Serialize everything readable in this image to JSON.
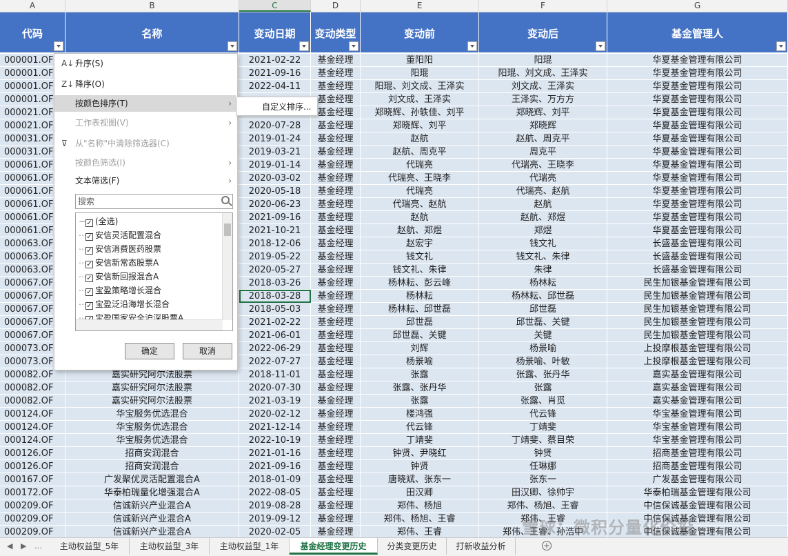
{
  "column_letters": [
    "A",
    "B",
    "C",
    "D",
    "E",
    "F",
    "G"
  ],
  "headers": [
    "代码",
    "名称",
    "变动日期",
    "变动类型",
    "变动前",
    "变动后",
    "基金管理人"
  ],
  "rows": [
    [
      "000001.OF",
      "",
      "2021-02-22",
      "基金经理",
      "董阳阳",
      "阳琨",
      "华夏基金管理有限公司"
    ],
    [
      "000001.OF",
      "",
      "2021-09-16",
      "基金经理",
      "阳琨",
      "阳琨、刘文成、王泽实",
      "华夏基金管理有限公司"
    ],
    [
      "000001.OF",
      "",
      "2022-04-11",
      "基金经理",
      "阳琨、刘文成、王泽实",
      "刘文成、王泽实",
      "华夏基金管理有限公司"
    ],
    [
      "000001.OF",
      "",
      "",
      "基金经理",
      "刘文成、王泽实",
      "王泽实、万方方",
      "华夏基金管理有限公司"
    ],
    [
      "000021.OF",
      "",
      "",
      "基金经理",
      "郑晓辉、孙轶佳、刘平",
      "郑晓辉、刘平",
      "华夏基金管理有限公司"
    ],
    [
      "000021.OF",
      "",
      "2020-07-28",
      "基金经理",
      "郑晓辉、刘平",
      "郑晓辉",
      "华夏基金管理有限公司"
    ],
    [
      "000031.OF",
      "",
      "2019-01-24",
      "基金经理",
      "赵航",
      "赵航、周克平",
      "华夏基金管理有限公司"
    ],
    [
      "000031.OF",
      "",
      "2019-03-21",
      "基金经理",
      "赵航、周克平",
      "周克平",
      "华夏基金管理有限公司"
    ],
    [
      "000061.OF",
      "",
      "2019-01-14",
      "基金经理",
      "代瑞亮",
      "代瑞亮、王晓李",
      "华夏基金管理有限公司"
    ],
    [
      "000061.OF",
      "",
      "2020-03-02",
      "基金经理",
      "代瑞亮、王晓李",
      "代瑞亮",
      "华夏基金管理有限公司"
    ],
    [
      "000061.OF",
      "",
      "2020-05-18",
      "基金经理",
      "代瑞亮",
      "代瑞亮、赵航",
      "华夏基金管理有限公司"
    ],
    [
      "000061.OF",
      "",
      "2020-06-23",
      "基金经理",
      "代瑞亮、赵航",
      "赵航",
      "华夏基金管理有限公司"
    ],
    [
      "000061.OF",
      "",
      "2021-09-16",
      "基金经理",
      "赵航",
      "赵航、郑煜",
      "华夏基金管理有限公司"
    ],
    [
      "000061.OF",
      "",
      "2021-10-21",
      "基金经理",
      "赵航、郑煜",
      "郑煜",
      "华夏基金管理有限公司"
    ],
    [
      "000063.OF",
      "",
      "2018-12-06",
      "基金经理",
      "赵宏宇",
      "钱文礼",
      "长盛基金管理有限公司"
    ],
    [
      "000063.OF",
      "",
      "2019-05-22",
      "基金经理",
      "钱文礼",
      "钱文礼、朱律",
      "长盛基金管理有限公司"
    ],
    [
      "000063.OF",
      "",
      "2020-05-27",
      "基金经理",
      "钱文礼、朱律",
      "朱律",
      "长盛基金管理有限公司"
    ],
    [
      "000067.OF",
      "",
      "2018-03-26",
      "基金经理",
      "杨林耘、彭云峰",
      "杨林耘",
      "民生加银基金管理有限公司"
    ],
    [
      "000067.OF",
      "",
      "2018-03-28",
      "基金经理",
      "杨林耘",
      "杨林耘、邱世磊",
      "民生加银基金管理有限公司"
    ],
    [
      "000067.OF",
      "",
      "2018-05-03",
      "基金经理",
      "杨林耘、邱世磊",
      "邱世磊",
      "民生加银基金管理有限公司"
    ],
    [
      "000067.OF",
      "",
      "2021-02-22",
      "基金经理",
      "邱世磊",
      "邱世磊、关键",
      "民生加银基金管理有限公司"
    ],
    [
      "000067.OF",
      "",
      "2021-06-01",
      "基金经理",
      "邱世磊、关键",
      "关键",
      "民生加银基金管理有限公司"
    ],
    [
      "000073.OF",
      "",
      "2022-06-29",
      "基金经理",
      "刘辉",
      "杨景喻",
      "上投摩根基金管理有限公司"
    ],
    [
      "000073.OF",
      "",
      "2022-07-27",
      "基金经理",
      "杨景喻",
      "杨景喻、叶敏",
      "上投摩根基金管理有限公司"
    ],
    [
      "000082.OF",
      "嘉实研究阿尔法股票",
      "2018-11-01",
      "基金经理",
      "张露",
      "张露、张丹华",
      "嘉实基金管理有限公司"
    ],
    [
      "000082.OF",
      "嘉实研究阿尔法股票",
      "2020-07-30",
      "基金经理",
      "张露、张丹华",
      "张露",
      "嘉实基金管理有限公司"
    ],
    [
      "000082.OF",
      "嘉实研究阿尔法股票",
      "2021-03-19",
      "基金经理",
      "张露",
      "张露、肖觅",
      "嘉实基金管理有限公司"
    ],
    [
      "000124.OF",
      "华宝服务优选混合",
      "2020-02-12",
      "基金经理",
      "楼鸿强",
      "代云锋",
      "华宝基金管理有限公司"
    ],
    [
      "000124.OF",
      "华宝服务优选混合",
      "2021-12-14",
      "基金经理",
      "代云锋",
      "丁靖斐",
      "华宝基金管理有限公司"
    ],
    [
      "000124.OF",
      "华宝服务优选混合",
      "2022-10-19",
      "基金经理",
      "丁靖斐",
      "丁靖斐、蔡目荣",
      "华宝基金管理有限公司"
    ],
    [
      "000126.OF",
      "招商安润混合",
      "2021-01-16",
      "基金经理",
      "钟贤、尹晓红",
      "钟贤",
      "招商基金管理有限公司"
    ],
    [
      "000126.OF",
      "招商安润混合",
      "2021-09-16",
      "基金经理",
      "钟贤",
      "任琳娜",
      "招商基金管理有限公司"
    ],
    [
      "000167.OF",
      "广发聚优灵活配置混合A",
      "2018-01-09",
      "基金经理",
      "唐晓斌、张东一",
      "张东一",
      "广发基金管理有限公司"
    ],
    [
      "000172.OF",
      "华泰柏瑞量化增强混合A",
      "2022-08-05",
      "基金经理",
      "田汉卿",
      "田汉卿、徐帅宇",
      "华泰柏瑞基金管理有限公司"
    ],
    [
      "000209.OF",
      "信诚新兴产业混合A",
      "2019-08-28",
      "基金经理",
      "郑伟、杨旭",
      "郑伟、杨旭、王睿",
      "中信保诚基金管理有限公司"
    ],
    [
      "000209.OF",
      "信诚新兴产业混合A",
      "2019-09-12",
      "基金经理",
      "郑伟、杨旭、王睿",
      "郑伟、王睿",
      "中信保诚基金管理有限公司"
    ],
    [
      "000209.OF",
      "信诚新兴产业混合A",
      "2020-02-05",
      "基金经理",
      "郑伟、王睿",
      "郑伟、王睿、孙浩中",
      "中信保诚基金管理有限公司"
    ]
  ],
  "filter_menu": {
    "sort_asc": "升序(S)",
    "sort_desc": "降序(O)",
    "sort_by_color": "按颜色排序(T)",
    "sheet_view": "工作表视图(V)",
    "clear_filter": "从\"名称\"中清除筛选器(C)",
    "filter_by_color": "按颜色筛选(I)",
    "text_filter": "文本筛选(F)",
    "search_placeholder": "搜索",
    "submenu_item": "自定义排序...",
    "options": [
      {
        "label": "(全选)",
        "checked": true
      },
      {
        "label": "安信灵活配置混合",
        "checked": true
      },
      {
        "label": "安信消费医药股票",
        "checked": true
      },
      {
        "label": "安信新常态股票A",
        "checked": true
      },
      {
        "label": "安信新回报混合A",
        "checked": true
      },
      {
        "label": "宝盈策略增长混合",
        "checked": true
      },
      {
        "label": "宝盈泛沿海增长混合",
        "checked": true
      },
      {
        "label": "宝盈国家安全沪深股票A",
        "checked": true
      }
    ],
    "ok_label": "确定",
    "cancel_label": "取消"
  },
  "sheet_tabs": [
    {
      "label": "主动权益型_5年",
      "active": false
    },
    {
      "label": "主动权益型_3年",
      "active": false
    },
    {
      "label": "主动权益型_1年",
      "active": false
    },
    {
      "label": "基金经理变更历史",
      "active": true
    },
    {
      "label": "分类变更历史",
      "active": false
    },
    {
      "label": "打新收益分析",
      "active": false
    }
  ],
  "watermark": "雪球：微积分量化价投",
  "colors": {
    "header": "#4472c4",
    "cell": "#dce6f1",
    "accent": "#217346"
  }
}
